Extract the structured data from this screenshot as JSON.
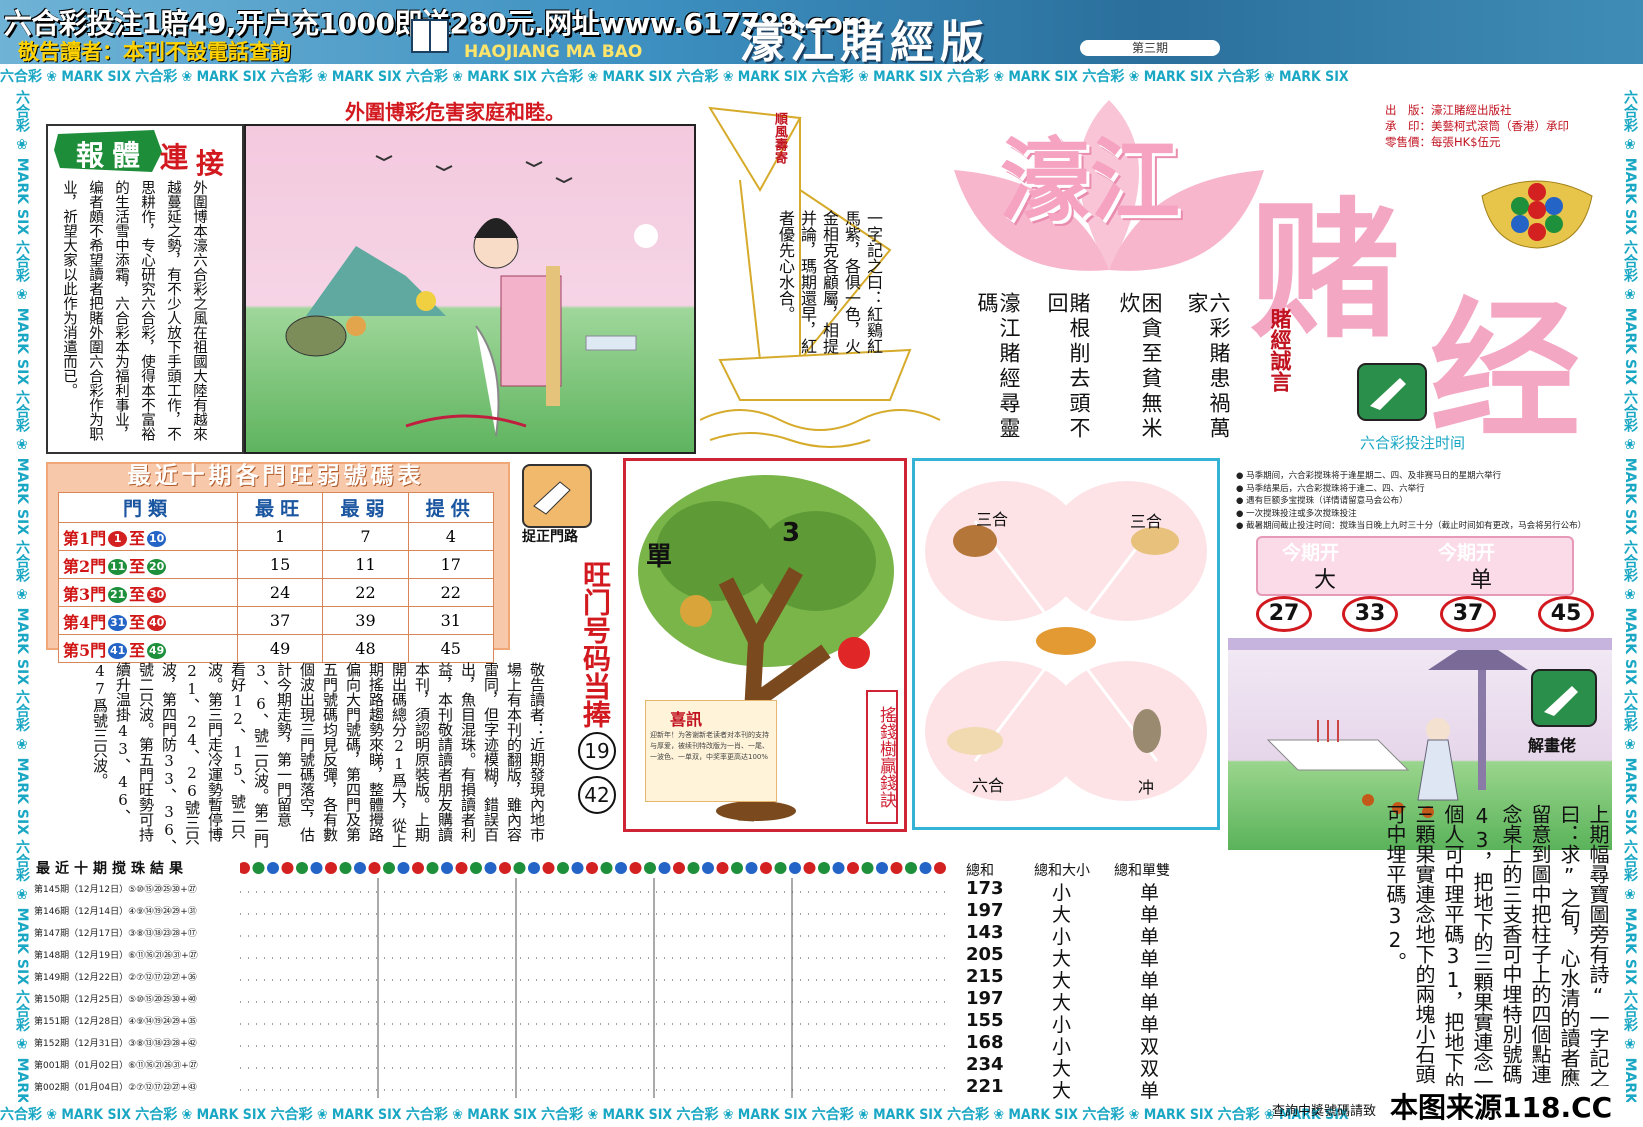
{
  "header": {
    "banner": "六合彩投注1賠49,开户充1000即送280元.网址www.617788.com",
    "notice": "敬告讀者：本刊不設電話查詢",
    "logo_en": "HAOJIANG MA BAO",
    "masthead": "濠江賭經版",
    "issue": "第三期"
  },
  "strip_text": "六合彩 ❀ MARK SIX 六合彩 ❀ MARK SIX 六合彩 ❀ MARK SIX 六合彩 ❀ MARK SIX 六合彩 ❀ MARK SIX 六合彩 ❀ MARK SIX 六合彩 ❀ MARK SIX 六合彩 ❀ MARK SIX 六合彩 ❀ MARK SIX 六合彩 ❀ MARK SIX",
  "slogan": "外圍博彩危害家庭和睦。",
  "left_box": {
    "t1": "報",
    "t2": "體",
    "t3": "連",
    "t4": "接",
    "text": "外圍博本濠六合彩之風在祖國大陸有越來越蔓延之勢，有不少人放下手頭工作，不思耕作，专心研究六合彩，使得本不富裕的生活雪中添霜，六合彩本为福利事业，编者頗不希望讀者把賭外圍六合彩作为职业，祈望大家以此作为消遣而已。"
  },
  "boat": {
    "sail": "順風壽寄",
    "poem": "一字記之曰：紅鷄紅馬紫，各俱一色，火金相克各顧屬，相提并論，瑪期還早，紅者優先心水合。"
  },
  "center_poem": [
    "六彩賭患禍萬家",
    "困貪至貧無米炊",
    "賭根削去頭不回",
    "濠江賭經尋靈碼"
  ],
  "big_title": {
    "a": "濠江",
    "b": "赌",
    "c": "经"
  },
  "pubinfo": [
    "出　版：濠江賭經出版社",
    "承　印：美藝柯式滾筒（香港）承印",
    "零售價：每張HK$伍元"
  ],
  "motto": "賭經誠言",
  "doors_table": {
    "title": "最近十期各門旺弱號碼表",
    "headers": [
      "門類",
      "最旺",
      "最弱",
      "提供"
    ],
    "rows": [
      {
        "door": "第1門",
        "from": "1",
        "to": "10",
        "hot": "1",
        "weak": "7",
        "offer": "4"
      },
      {
        "door": "第2門",
        "from": "11",
        "to": "20",
        "hot": "15",
        "weak": "11",
        "offer": "17"
      },
      {
        "door": "第3門",
        "from": "21",
        "to": "30",
        "hot": "24",
        "weak": "22",
        "offer": "22"
      },
      {
        "door": "第4門",
        "from": "31",
        "to": "40",
        "hot": "37",
        "weak": "39",
        "offer": "31"
      },
      {
        "door": "第5門",
        "from": "41",
        "to": "49",
        "hot": "49",
        "weak": "48",
        "offer": "45"
      }
    ]
  },
  "hint_label": "捉正門路",
  "hot_door": {
    "label": "旺门号码当捧",
    "n1": "19",
    "n2": "42"
  },
  "mid_text": "敬告讀者：近期發現內地市場上有本刊的翻版，雖內容雷同，但字迹模糊，錯誤百出，魚目混珠。有損讀者利益，本刊敬請讀者朋友購讀本刊，須認明原裝版。上期開出碼總分21爲大，從上期搖路趨勢來睇，整體攪路偏向大門號碼，第四門及第五門號碼均見反彈，各有數個波出現三門號碼落空，估計今期走勢，第一門留意3、6、號二只波。第二門看好12、15、號二只波。第三門走冷運勢暫停博21、24、26號三只波，第四門防33、36、號二只波。第五門旺勢可持續升温掛43、46、47爲號三只波。",
  "tree": {
    "dan": "單",
    "num": "3",
    "sign": "搖錢樹贏錢訣",
    "xi_title": "喜訊",
    "xi_text": "迎新年！为答谢新老读者对本刊的支持与厚爱，被续刊特改版为一肖、一尾、一波色、一单双，中奖率更高达100%"
  },
  "zodiac": {
    "sanhe1": "三合",
    "sanhe2": "三合",
    "liuhe": "六合",
    "chong": "冲"
  },
  "info": {
    "title": "六合彩投注时间",
    "lines": [
      "● 马季期间，六合彩搅珠将于逢星期二、四、及非赛马日的星期六举行",
      "● 马季结果后，六合彩搅珠将于逢二、四、六举行",
      "● 遇有巨额多宝搅珠（详情请留意马会公布）",
      "● 一次搅珠投注或多次搅珠投注",
      "● 截暑期间截止投注时间：搅珠当日晚上九时三十分（截止时间如有更改，马会将另行公布）"
    ]
  },
  "kaiban": {
    "t1": "今期开",
    "v1": "大",
    "t2": "今期开",
    "v2": "单"
  },
  "picks": [
    "27",
    "33",
    "37",
    "45"
  ],
  "jiemi": "解畫佬",
  "right_poem": "上期幅尋寶圖旁有詩“一字記之曰：求”之旬，心水清的讀者應留意到圖中把柱子上的四個點連念桌上的三支香可中埋特別號碼43，把地下的三顆果實連念一個人可中理平碼31，把地下的三顆果實連念地下的兩塊小石頭可中埋平碼32。",
  "results": {
    "title": "最近十期搅珠結果",
    "sum_header": "總和",
    "size_header": "總和大小",
    "odd_header": "總和單雙",
    "rows": [
      {
        "label": "第145期（12月12日）⑤⑩⑮⑳㉕㉚+㉗",
        "sum": "173",
        "size": "小",
        "odd": "单"
      },
      {
        "label": "第146期（12月14日）④⑨⑭⑲㉔㉙+㉛",
        "sum": "197",
        "size": "大",
        "odd": "单"
      },
      {
        "label": "第147期（12月17日）③⑧⑬⑱㉓㉘+⑰",
        "sum": "143",
        "size": "小",
        "odd": "单"
      },
      {
        "label": "第148期（12月19日）⑥⑪⑯㉑㉖㉛+㉗",
        "sum": "205",
        "size": "大",
        "odd": "单"
      },
      {
        "label": "第149期（12月22日）②⑦⑫⑰㉒㉗+㊱",
        "sum": "215",
        "size": "大",
        "odd": "单"
      },
      {
        "label": "第150期（12月25日）⑤⑩⑮⑳㉕㉚+㊵",
        "sum": "197",
        "size": "大",
        "odd": "单"
      },
      {
        "label": "第151期（12月28日）④⑨⑭⑲㉔㉙+㉟",
        "sum": "155",
        "size": "小",
        "odd": "单"
      },
      {
        "label": "第152期（12月31日）③⑧⑬⑱㉓㉘+㊷",
        "sum": "168",
        "size": "小",
        "odd": "双"
      },
      {
        "label": "第001期（01月02日）⑥⑪⑯㉑㉖㉛+㉗",
        "sum": "234",
        "size": "大",
        "odd": "双"
      },
      {
        "label": "第002期（01月04日）②⑦⑫⑰㉒㉗+㊸",
        "sum": "221",
        "size": "大",
        "odd": "单"
      }
    ]
  },
  "footer": {
    "source": "本图来源118.CC",
    "query": "查詢中獎號碼請致"
  }
}
